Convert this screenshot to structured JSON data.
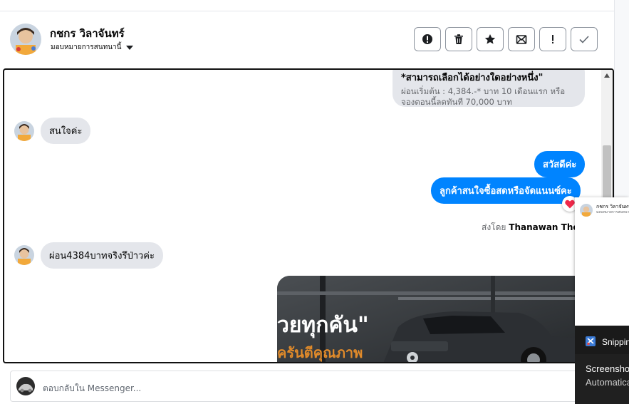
{
  "header": {
    "contact_name": "กชกร วิลาจันทร์",
    "assign_label": "มอบหมายการสนทนานี้"
  },
  "toolbar": {
    "buttons": [
      {
        "icon": "spam-alert-icon"
      },
      {
        "icon": "trash-icon"
      },
      {
        "icon": "star-icon"
      },
      {
        "icon": "mark-unread-icon"
      },
      {
        "icon": "important-icon"
      },
      {
        "icon": "checkmark-icon"
      }
    ]
  },
  "messages": {
    "card_title": "*สามารถเลือกได้อย่างใดอย่างหนึ่ง\"",
    "card_body": "ผ่อนเริ่มต้น : 4,384.-* บาท 10 เดือนแรก หรือ จองตอนนี้ลดทันที 70,000 บาท",
    "in_1": "สนใจค่ะ",
    "out_1": "สวัสดีค่ะ",
    "out_2": "ลูกค้าสนใจซื้อสดหรือจัดแนนซ์คะ",
    "sent_by_prefix": "ส่งโดย",
    "sent_by_name": "Thanawan Thon",
    "in_2": "ผ่อน4384บาทจริงรึป่าวค่ะ",
    "image_caption_line1": "วยทุกคัน\"",
    "image_caption_line2": "ครันตีคุณภาพ"
  },
  "reply": {
    "placeholder": "ตอบกลับใน Messenger..."
  },
  "popup": {
    "name": "กชกร วิลาจันทร์",
    "sub": "มอบหมายการสนทนานี้"
  },
  "snipping": {
    "app_name": "Snipping Tool",
    "line1": "Screenshot",
    "line2": "Automatically"
  },
  "colors": {
    "outgoing_bubble": "#0084ff",
    "incoming_bubble": "#e4e6eb",
    "heart": "#f02849"
  }
}
